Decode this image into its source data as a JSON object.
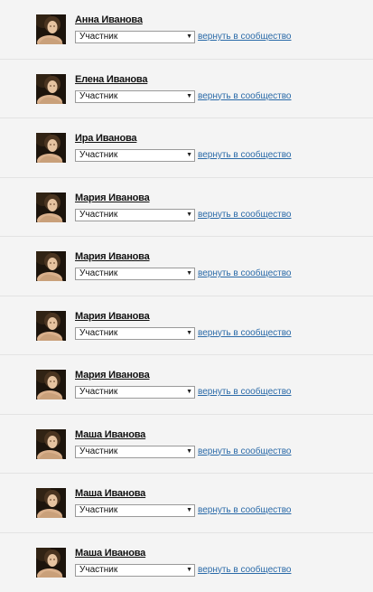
{
  "restore_label": "вернуть в сообщество",
  "members": [
    {
      "name": "Анна Иванова",
      "role": "Участник"
    },
    {
      "name": "Елена Иванова",
      "role": "Участник"
    },
    {
      "name": "Ира Иванова",
      "role": "Участник"
    },
    {
      "name": "Мария Иванова",
      "role": "Участник"
    },
    {
      "name": "Мария Иванова",
      "role": "Участник"
    },
    {
      "name": "Мария Иванова",
      "role": "Участник"
    },
    {
      "name": "Мария Иванова",
      "role": "Участник"
    },
    {
      "name": "Маша Иванова",
      "role": "Участник"
    },
    {
      "name": "Маша Иванова",
      "role": "Участник"
    },
    {
      "name": "Маша Иванова",
      "role": "Участник"
    }
  ],
  "icons": {
    "dropdown": "chevron-down-icon"
  },
  "colors": {
    "link": "#2a6aa8",
    "background": "#f4f4f4",
    "divider": "#e3e3e3"
  }
}
